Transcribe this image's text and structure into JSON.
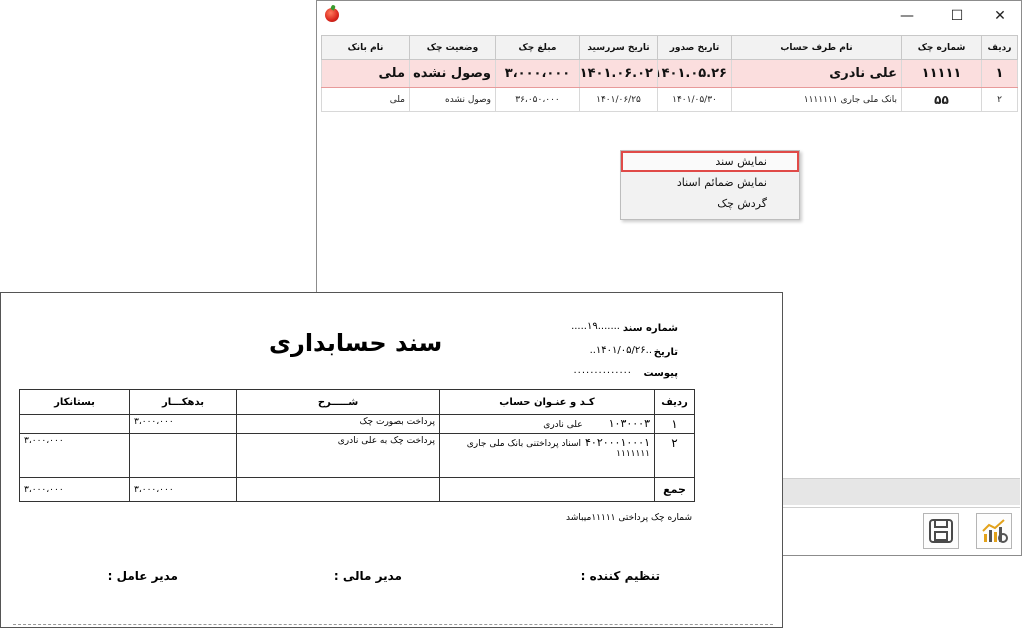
{
  "window": {
    "controls": {
      "minimize": "—",
      "maximize": "☐",
      "close": "✕"
    },
    "grid": {
      "columns": [
        "ردیف",
        "شماره چک",
        "نام طرف حساب",
        "تاریخ صدور",
        "تاریخ سررسید",
        "مبلغ چک",
        "وضعیت چک",
        "نام بانک"
      ],
      "rows": [
        {
          "row": "۱",
          "number": "۱۱۱۱۱",
          "party": "علی نادری",
          "issue": "۱۴۰۱.۰۵.۲۶",
          "due": "۱۴۰۱.۰۶.۰۲",
          "amount": "۳،۰۰۰،۰۰۰",
          "status": "وصول نشده",
          "bank": "ملی"
        },
        {
          "row": "۲",
          "number": "۵۵",
          "party": "بانک ملی جاری ۱۱۱۱۱۱۱",
          "issue": "۱۴۰۱/۰۵/۳۰",
          "due": "۱۴۰۱/۰۶/۲۵",
          "amount": "۳۶،۰۵۰،۰۰۰",
          "status": "وصول نشده",
          "bank": "ملی"
        }
      ]
    },
    "context_menu": [
      "نمایش سند",
      "نمایش ضمائم اسناد",
      "گردش چک"
    ]
  },
  "document": {
    "title": "سند حسابداری",
    "doc_number_label": "شماره سند",
    "doc_number": "۱۹",
    "date_label": "تاریخ",
    "date": "۱۴۰۱/۰۵/۲۶",
    "attachment_label": "پیوست",
    "table": {
      "headers": [
        "ردیف",
        "کـد و عنـوان حساب",
        "شـــــرح",
        "بدهکـــار",
        "بستانکار"
      ],
      "rows": [
        {
          "row": "۱",
          "code": "۱۰۳۰۰۰۳",
          "account": "علی نادری",
          "desc": "پرداخت بصورت چک",
          "debit": "۳،۰۰۰،۰۰۰",
          "credit": ""
        },
        {
          "row": "۲",
          "code": "۴۰۲۰۰۰۱۰۰۰۱",
          "account": "اسناد پرداختنی بانک ملی جاری ۱۱۱۱۱۱۱",
          "desc": "پرداخت چک به علی نادری",
          "debit": "",
          "credit": "۳،۰۰۰،۰۰۰"
        }
      ],
      "total_label": "جمع",
      "total_debit": "۳،۰۰۰،۰۰۰",
      "total_credit": "۳،۰۰۰،۰۰۰"
    },
    "note": "شماره چک پرداختی ۱۱۱۱۱میباشد",
    "signatures": {
      "preparer": "تنظیم کننده :",
      "finance": "مدیر مالی :",
      "ceo": "مدیر عامل :"
    }
  }
}
